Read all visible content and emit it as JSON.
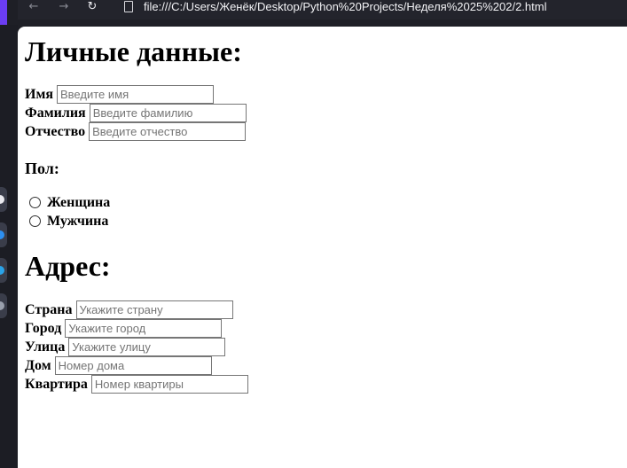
{
  "browser": {
    "url": "file:///C:/Users/Женёк/Desktop/Python%20Projects/Неделя%2025%202/2.html",
    "back_icon": "back-arrow-icon",
    "forward_icon": "forward-arrow-icon",
    "reload_icon": "reload-icon",
    "page_icon": "file-icon"
  },
  "colors": {
    "accent": "#6b3df2",
    "chrome_bg": "#23242c",
    "page_bg": "#ffffff"
  },
  "personal": {
    "heading": "Личные данные:",
    "first_name": {
      "label": "Имя",
      "placeholder": "Введите имя",
      "value": ""
    },
    "last_name": {
      "label": "Фамилия",
      "placeholder": "Введите фамилию",
      "value": ""
    },
    "middle_name": {
      "label": "Отчество",
      "placeholder": "Введите отчество",
      "value": ""
    }
  },
  "gender": {
    "heading": "Пол:",
    "options": [
      "Женщина",
      "Мужчина"
    ],
    "selected": null
  },
  "address": {
    "heading": "Адрес:",
    "country": {
      "label": "Страна",
      "placeholder": "Укажите страну",
      "value": ""
    },
    "city": {
      "label": "Город",
      "placeholder": "Укажите город",
      "value": ""
    },
    "street": {
      "label": "Улица",
      "placeholder": "Укажите улицу",
      "value": ""
    },
    "house": {
      "label": "Дом",
      "placeholder": "Номер дома",
      "value": ""
    },
    "apartment": {
      "label": "Квартира",
      "placeholder": "Номер квартиры",
      "value": ""
    }
  }
}
